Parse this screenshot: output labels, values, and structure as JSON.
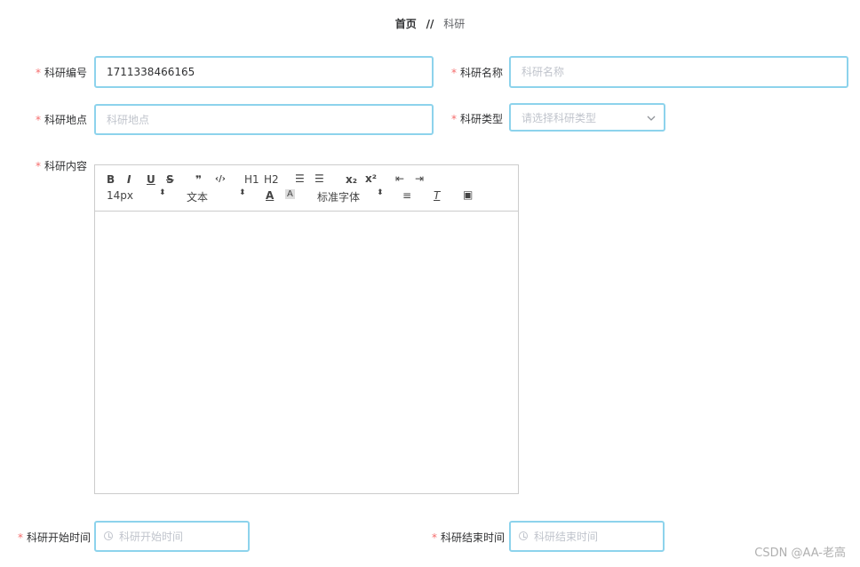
{
  "breadcrumb": {
    "home": "首页",
    "separator": "//",
    "current": "科研"
  },
  "form": {
    "research_no": {
      "label": "科研编号",
      "value": "1711338466165"
    },
    "research_name": {
      "label": "科研名称",
      "placeholder": "科研名称"
    },
    "research_place": {
      "label": "科研地点",
      "placeholder": "科研地点"
    },
    "research_type": {
      "label": "科研类型",
      "placeholder": "请选择科研类型"
    },
    "research_content": {
      "label": "科研内容"
    },
    "start_time": {
      "label": "科研开始时间",
      "placeholder": "科研开始时间"
    },
    "end_time": {
      "label": "科研结束时间",
      "placeholder": "科研结束时间"
    }
  },
  "editor": {
    "toolbar": {
      "bold": "B",
      "italic": "I",
      "underline": "U",
      "strike": "S",
      "quote": "❞",
      "code": "‹/›",
      "h1": "H1",
      "h2": "H2",
      "ordered_list": "☰",
      "bullet_list": "☰",
      "subscript": "x₂",
      "superscript": "x²",
      "outdent": "⇤",
      "indent": "⇥",
      "size": "14px",
      "header": "文本",
      "font_family": "标准字体",
      "color": "A",
      "background": "A",
      "align": "≡",
      "clean": "T",
      "image": "▣"
    }
  },
  "watermark": "CSDN @AA-老高",
  "colors": {
    "required": "#f56c6c",
    "focus_border": "#8dd3ec",
    "placeholder": "#c0c4cc"
  }
}
